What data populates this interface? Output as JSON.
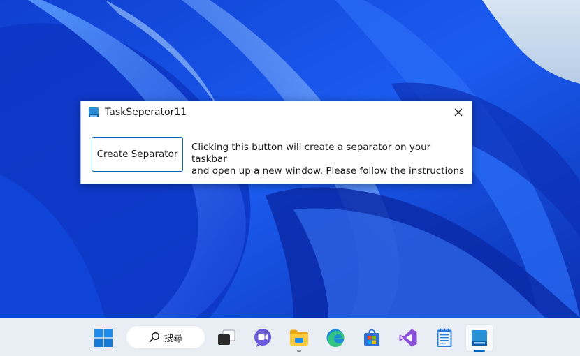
{
  "window": {
    "title": "TaskSeperator11",
    "close_glyph": "✕",
    "button_label": "Create Separator",
    "description_line1": "Clicking this button will create a separator on your taskbar",
    "description_line2": "and open up a new window. Please follow the instructions"
  },
  "taskbar": {
    "search_label": "搜尋",
    "items": [
      {
        "name": "start",
        "icon": "windows-logo-icon"
      },
      {
        "name": "search",
        "icon": "search-icon"
      },
      {
        "name": "task-view",
        "icon": "task-view-icon"
      },
      {
        "name": "chat",
        "icon": "chat-icon"
      },
      {
        "name": "file-explorer",
        "icon": "folder-icon",
        "running": true
      },
      {
        "name": "edge",
        "icon": "edge-icon"
      },
      {
        "name": "microsoft-store",
        "icon": "store-icon"
      },
      {
        "name": "visual-studio",
        "icon": "visual-studio-icon"
      },
      {
        "name": "notepad",
        "icon": "notepad-icon"
      },
      {
        "name": "taskseperator11",
        "icon": "app-window-icon",
        "running": true,
        "active": true
      }
    ]
  },
  "colors": {
    "accent": "#0067c0",
    "wallpaper_deep": "#0a2fb8",
    "wallpaper_light": "#7fb2ff",
    "taskbar_bg": "#e9eef4"
  }
}
